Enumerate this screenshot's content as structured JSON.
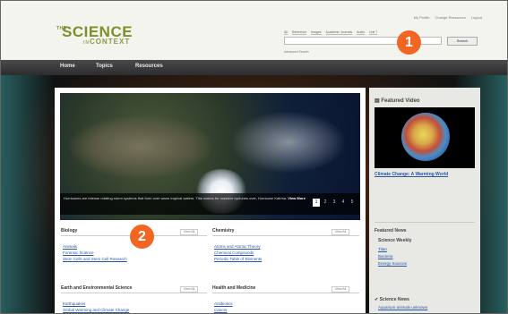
{
  "header": {
    "logo": {
      "prefix": "THE",
      "name": "SCIENCE",
      "in": "IN",
      "context": "CONTEXT"
    },
    "top_links": [
      "My Profile",
      "Change Resources",
      "Logout"
    ],
    "search_scopes": [
      "All",
      "Reference",
      "Images",
      "Academic Journals",
      "Audio",
      "Unit 7"
    ],
    "search_placeholder": "",
    "search_button": "Search",
    "advanced_search": "Advanced Search"
  },
  "nav": {
    "items": [
      "Home",
      "Topics",
      "Resources"
    ]
  },
  "hero": {
    "caption": "Hurricanes are intense rotating storm systems that form over warm tropical waters. This makes for massive cyclones over, Hurricane Katrina.",
    "view_more": "View More",
    "pages": [
      "1",
      "2",
      "3",
      "4",
      "5"
    ],
    "active_page": 0
  },
  "sections": [
    {
      "title": "Biology",
      "view_all": "View All",
      "links": [
        "Animals",
        "Forensic Science",
        "Stem Cells and Stem Cell Research"
      ]
    },
    {
      "title": "Chemistry",
      "view_all": "View All",
      "links": [
        "Atoms and Atomic Theory",
        "Chemical Compounds",
        "Periodic Table of Elements"
      ]
    },
    {
      "title": "Earth and Environmental Science",
      "view_all": "View All",
      "links": [
        "Earthquakes",
        "Global Warming and Climate Change"
      ]
    },
    {
      "title": "Health and Medicine",
      "view_all": "View All",
      "links": [
        "Antibiotics",
        "Cancer"
      ]
    }
  ],
  "sidebar": {
    "featured_video_title": "Featured Video",
    "video_title": "Climate Change: A Warming World",
    "featured_news_title": "Featured News",
    "news_heading": "Science Weekly",
    "news_links": [
      "Titan",
      "Bacteria",
      "Energy Sources"
    ],
    "science_news_title": "Science News",
    "science_news_link": "Aquarium animals unknown"
  },
  "callouts": [
    "1",
    "2"
  ],
  "colors": {
    "accent": "#f26522",
    "link": "#2a57a8",
    "logo": "#7c8f2a"
  }
}
